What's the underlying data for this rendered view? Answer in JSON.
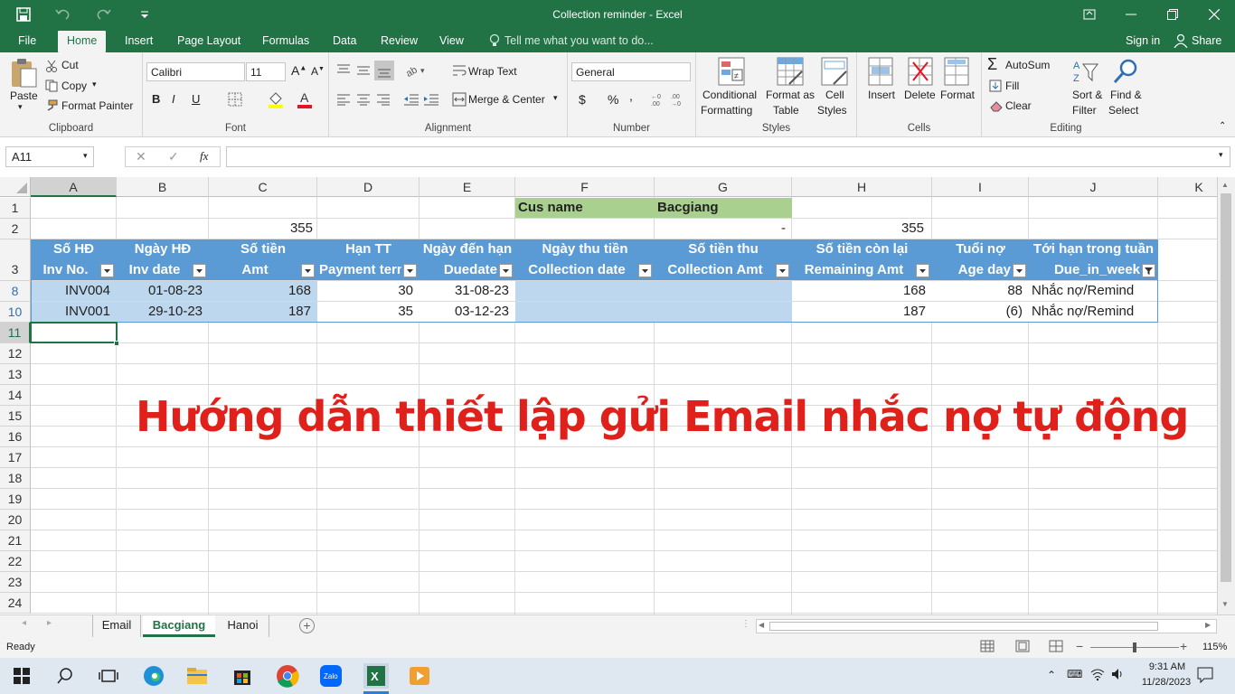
{
  "window": {
    "title": "Collection reminder - Excel"
  },
  "menu": {
    "tabs": [
      "File",
      "Home",
      "Insert",
      "Page Layout",
      "Formulas",
      "Data",
      "Review",
      "View"
    ],
    "tell_me": "Tell me what you want to do...",
    "sign_in": "Sign in",
    "share": "Share"
  },
  "ribbon": {
    "clipboard": {
      "paste": "Paste",
      "cut": "Cut",
      "copy": "Copy",
      "format_painter": "Format Painter",
      "label": "Clipboard"
    },
    "font": {
      "name": "Calibri",
      "size": "11",
      "bold": "B",
      "italic": "I",
      "underline": "U",
      "label": "Font"
    },
    "alignment": {
      "wrap": "Wrap Text",
      "merge": "Merge & Center",
      "label": "Alignment"
    },
    "number": {
      "format": "General",
      "currency": "$",
      "percent": "%",
      "comma": ",",
      "label": "Number"
    },
    "styles": {
      "conditional_1": "Conditional",
      "conditional_2": "Formatting",
      "format_table_1": "Format as",
      "format_table_2": "Table",
      "cell_styles_1": "Cell",
      "cell_styles_2": "Styles",
      "label": "Styles"
    },
    "cells": {
      "insert": "Insert",
      "delete": "Delete",
      "format": "Format",
      "label": "Cells"
    },
    "editing": {
      "autosum": "AutoSum",
      "fill": "Fill",
      "clear": "Clear",
      "sort_1": "Sort &",
      "sort_2": "Filter",
      "find_1": "Find &",
      "find_2": "Select",
      "label": "Editing"
    }
  },
  "formula_bar": {
    "name_box": "A11",
    "fx": "fx",
    "content": ""
  },
  "columns": [
    "A",
    "B",
    "C",
    "D",
    "E",
    "F",
    "G",
    "H",
    "I",
    "J",
    "K"
  ],
  "rows": [
    "1",
    "2",
    "3",
    "8",
    "10",
    "11",
    "12",
    "13",
    "14",
    "15",
    "16",
    "17",
    "18",
    "19",
    "20",
    "21",
    "22",
    "23",
    "24"
  ],
  "cells": {
    "F1": "Cus name",
    "G1": "Bacgiang",
    "C2": "355",
    "G2": "-",
    "H2": "355"
  },
  "table": {
    "headers_vi": [
      "Số HĐ",
      "Ngày HĐ",
      "Số tiền",
      "Hạn TT",
      "Ngày đến hạn",
      "Ngày thu tiền",
      "Số tiền thu",
      "Số tiền còn lại",
      "Tuổi nợ",
      "Tới hạn trong tuần"
    ],
    "headers_en": [
      "Inv No.",
      "Inv date",
      "Amt",
      "Payment term",
      "Duedate",
      "Collection date",
      "Collection Amt",
      "Remaining Amt",
      "Age day",
      "Due_in_week"
    ],
    "rows": [
      [
        "INV004",
        "01-08-23",
        "168",
        "30",
        "31-08-23",
        "",
        "",
        "168",
        "88",
        "Nhắc nợ/Remind"
      ],
      [
        "INV001",
        "29-10-23",
        "187",
        "35",
        "03-12-23",
        "",
        "",
        "187",
        "(6)",
        "Nhắc nợ/Remind"
      ]
    ]
  },
  "overlay_text": "Hướng dẫn thiết lập gửi Email nhắc nợ tự động",
  "sheets": {
    "tabs": [
      "Email",
      "Bacgiang",
      "Hanoi"
    ],
    "active": "Bacgiang"
  },
  "status": {
    "text": "Ready",
    "zoom": "115%"
  },
  "taskbar": {
    "time": "9:31 AM",
    "date": "11/28/2023"
  },
  "colors": {
    "excel_green": "#217346",
    "table_header": "#5b9bd5",
    "table_band": "#bdd7ee",
    "cus_fill": "#a9d08e",
    "overlay_red": "#e0201b"
  }
}
